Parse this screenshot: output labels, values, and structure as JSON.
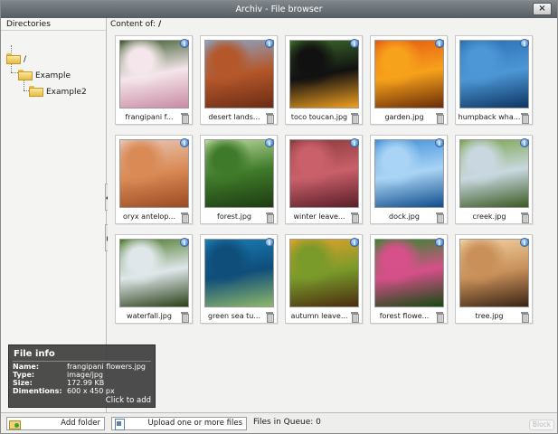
{
  "window": {
    "title": "Archiv - File browser",
    "close_label": "×"
  },
  "directories": {
    "header": "Directories",
    "items": [
      {
        "label": "/",
        "level": 0
      },
      {
        "label": "Example",
        "level": 1
      },
      {
        "label": "Example2",
        "level": 2
      }
    ]
  },
  "content": {
    "header_label": "Content of:",
    "path": "/",
    "files": [
      {
        "name": "frangipani f...",
        "icon": "flowers-photo",
        "palette": [
          "#3a5a2a",
          "#f4e6ea",
          "#c98aa4"
        ]
      },
      {
        "name": "desert lands...",
        "icon": "desert-photo",
        "palette": [
          "#8aa6c9",
          "#b4572a",
          "#6b2c15"
        ]
      },
      {
        "name": "toco toucan.jpg",
        "icon": "toucan-photo",
        "palette": [
          "#3d6b2a",
          "#111111",
          "#f0a020"
        ]
      },
      {
        "name": "garden.jpg",
        "icon": "garden-photo",
        "palette": [
          "#e45a12",
          "#f7a21b",
          "#6a2c08"
        ]
      },
      {
        "name": "humpback wha...",
        "icon": "whale-photo",
        "palette": [
          "#2a6fb5",
          "#4d97d6",
          "#0d3563"
        ]
      },
      {
        "name": "oryx antelop...",
        "icon": "oryx-photo",
        "palette": [
          "#e8c7b8",
          "#d98a55",
          "#9b4a22"
        ]
      },
      {
        "name": "forest.jpg",
        "icon": "forest-photo",
        "palette": [
          "#b9d99a",
          "#3f7a2a",
          "#1e3b12"
        ]
      },
      {
        "name": "winter leave...",
        "icon": "leaves-photo",
        "palette": [
          "#8a3a3a",
          "#c9606a",
          "#5a1e28"
        ]
      },
      {
        "name": "dock.jpg",
        "icon": "dock-photo",
        "palette": [
          "#3f8fd8",
          "#a9d4f5",
          "#0f4d8c"
        ]
      },
      {
        "name": "creek.jpg",
        "icon": "creek-photo",
        "palette": [
          "#7aa34a",
          "#c9d8e0",
          "#3a5a22"
        ]
      },
      {
        "name": "waterfall.jpg",
        "icon": "waterfall-photo",
        "palette": [
          "#4d7a2a",
          "#dfe7ea",
          "#2a4018"
        ]
      },
      {
        "name": "green sea tu...",
        "icon": "turtle-photo",
        "palette": [
          "#1a7fb5",
          "#0f4d7a",
          "#8fb86a"
        ]
      },
      {
        "name": "autumn leave...",
        "icon": "autumn-photo",
        "palette": [
          "#e3a12a",
          "#7a9a2a",
          "#4a2c10"
        ]
      },
      {
        "name": "forest flowe...",
        "icon": "forest-flowers-photo",
        "palette": [
          "#2f8a2a",
          "#d6508a",
          "#154a12"
        ]
      },
      {
        "name": "tree.jpg",
        "icon": "tree-photo",
        "palette": [
          "#f2d2a0",
          "#c9905a",
          "#3a2414"
        ]
      }
    ]
  },
  "file_info": {
    "title": "File info",
    "rows": [
      {
        "key": "Name:",
        "value": "frangipani flowers.jpg"
      },
      {
        "key": "Type:",
        "value": "image/jpg"
      },
      {
        "key": "Size:",
        "value": "172.99 KB"
      },
      {
        "key": "Dimentions:",
        "value": "600 x 450 px"
      }
    ],
    "action": "Click to add"
  },
  "statusbar": {
    "add_folder_label": "Add folder",
    "upload_label": "Upload one or more files",
    "queue_label": "Files in Queue:",
    "queue_count": "0",
    "block_label": "Block"
  }
}
